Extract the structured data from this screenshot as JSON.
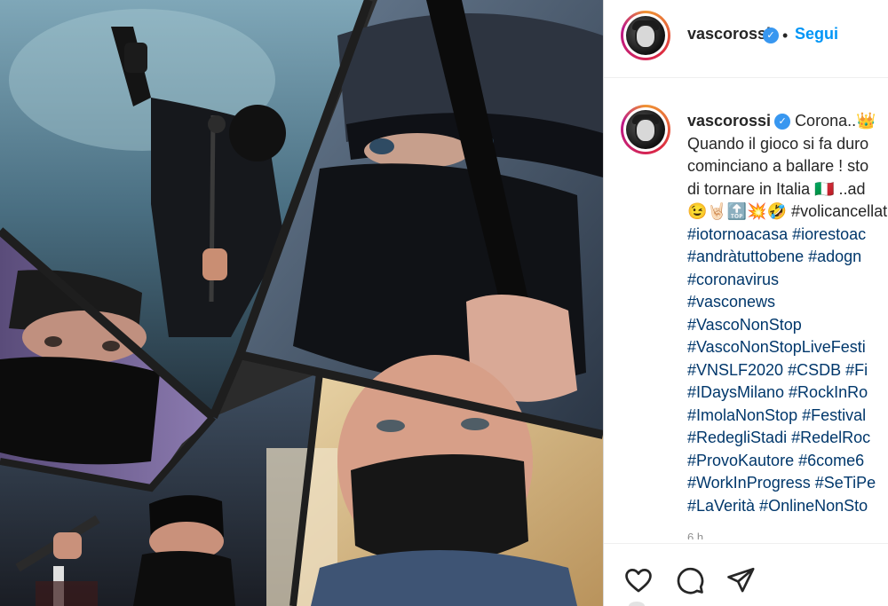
{
  "post": {
    "author": {
      "username": "vascorossi",
      "verified": true,
      "follow_label": "Segui",
      "separator": "•"
    },
    "caption": {
      "username": "vascorossi",
      "lines": [
        "Corona..👑",
        "Quando il gioco si fa duro",
        "cominciano a ballare ! sto",
        "di tornare in Italia 🇮🇹 ..ad",
        "😉🤘🏻🔝💥🤣 #volicancellat"
      ],
      "hashtag_lines": [
        "#iotornoacasa #iorestoac",
        "#andràtuttobene #adogn",
        "#coronavirus",
        "#vasconews",
        "#VascoNonStop",
        "#VascoNonStopLiveFesti",
        "#VNSLF2020 #CSDB #Fi",
        "#IDaysMilano #RockInRo",
        "#ImolaNonStop #Festival",
        "#RedegliStadi #RedelRoc",
        "#ProvoKautore #6come6",
        "#WorkInProgress #SeTiPe",
        "#LaVerità #OnlineNonSto"
      ],
      "timestamp": "6 h"
    },
    "actions": {
      "icons": [
        "heart-icon",
        "comment-icon",
        "share-icon"
      ]
    },
    "colors": {
      "link": "#0095f6",
      "hashtag": "#00376b",
      "verified": "#3897f0",
      "text": "#262626"
    }
  }
}
